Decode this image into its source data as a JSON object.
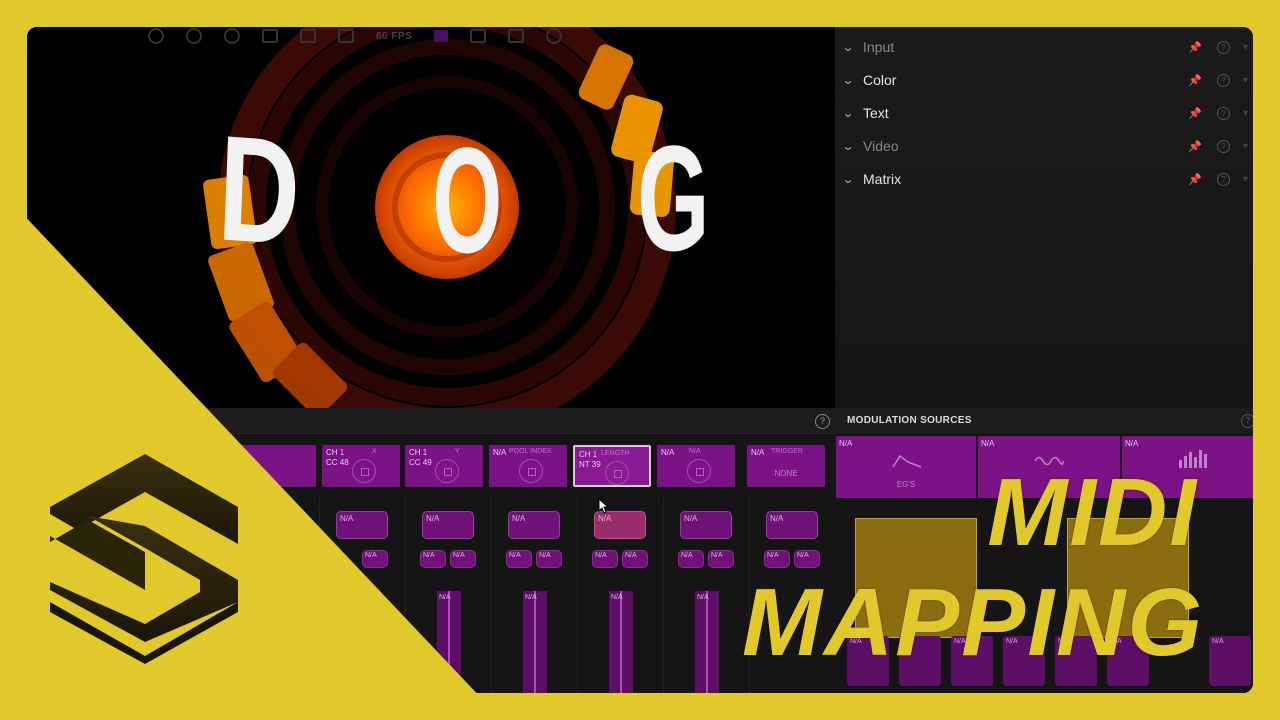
{
  "toolbar": {
    "fps": "60 FPS"
  },
  "canvas": {
    "letters": [
      "D",
      "O",
      "G"
    ]
  },
  "panel": {
    "rows": [
      {
        "label": "Input",
        "active": false
      },
      {
        "label": "Color",
        "active": true
      },
      {
        "label": "Text",
        "active": true
      },
      {
        "label": "Video",
        "active": false
      },
      {
        "label": "Matrix",
        "active": true
      }
    ]
  },
  "mod_sources": {
    "title": "MODULATION SOURCES",
    "tiles": [
      {
        "na": "N/A",
        "label": "EG'S"
      },
      {
        "na": "N/A",
        "label": ""
      },
      {
        "na": "N/A",
        "label": ""
      }
    ]
  },
  "slots": [
    {
      "line1": "CH 1",
      "line2": "CC 48",
      "param": "X"
    },
    {
      "line1": "CH 1",
      "line2": "CC 49",
      "param": "Y"
    },
    {
      "line1": "N/A",
      "line2": "",
      "param": "POOL INDEX"
    },
    {
      "line1": "CH 1",
      "line2": "NT 39",
      "param": "LENGTH"
    },
    {
      "line1": "N/A",
      "line2": "",
      "param": "N/A"
    },
    {
      "line1": "N/A",
      "line2": "",
      "param": "TRIGGER",
      "value": "NONE"
    }
  ],
  "columns": [
    {
      "btn": "N/A",
      "s1": "N/A",
      "s2": "N/A",
      "fader": "N/A"
    },
    {
      "btn": "N/A",
      "s1": "N/A",
      "s2": "N/A",
      "fader": "N/A"
    },
    {
      "btn": "N/A",
      "s1": "N/A",
      "s2": "N/A",
      "fader": "N/A"
    },
    {
      "btn": "N/A",
      "s1": "N/A",
      "s2": "N/A",
      "fader": "N/A"
    },
    {
      "btn": "N/A",
      "s1": "N/A",
      "s2": "N/A",
      "fader": "N/A"
    },
    {
      "btn": "N/A",
      "s1": "N/A",
      "s2": "N/A",
      "fader": ""
    }
  ],
  "bottom_tiles": [
    "N/A",
    "N/A",
    "N/A",
    "N/A",
    "N/A",
    "N/A",
    "N/A"
  ],
  "overlay": {
    "line1": "MIDI",
    "line2": "MAPPING"
  },
  "colors": {
    "brand_yellow": "#e2c92b",
    "mod_purple": "#7b1386"
  }
}
